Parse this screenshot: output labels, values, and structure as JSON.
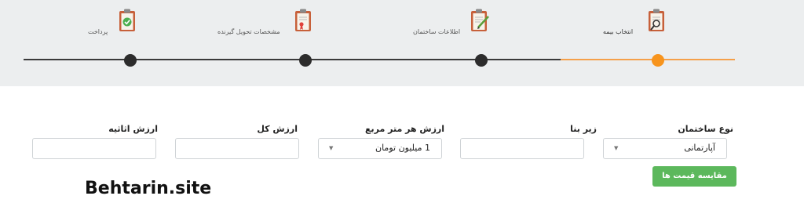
{
  "stepper": {
    "steps": [
      {
        "label": "انتخاب بیمه",
        "icon": "clipboard-magnifier-icon",
        "state": "active"
      },
      {
        "label": "اطلاعات ساختمان",
        "icon": "clipboard-pencil-icon",
        "state": "todo"
      },
      {
        "label": "مشخصات تحویل گیرنده",
        "icon": "clipboard-certificate-icon",
        "state": "todo"
      },
      {
        "label": "پرداخت",
        "icon": "clipboard-check-icon",
        "state": "todo"
      }
    ]
  },
  "form": {
    "building_type": {
      "label": "نوع ساختمان",
      "value": "آپارتمانی"
    },
    "area": {
      "label": "زیر بنا",
      "value": ""
    },
    "price_per_meter": {
      "label": "ارزش هر متر مربع",
      "value": "1 میلیون تومان"
    },
    "total_value": {
      "label": "ارزش کل",
      "value": ""
    },
    "furniture_value": {
      "label": "ارزش اثاثیه",
      "value": ""
    },
    "compare_button": "مقایسه قیمت ها"
  },
  "watermark": "Behtarin.site",
  "colors": {
    "accent": "#f7941d",
    "button": "#5cb85c",
    "header_bg": "#eceeef"
  }
}
